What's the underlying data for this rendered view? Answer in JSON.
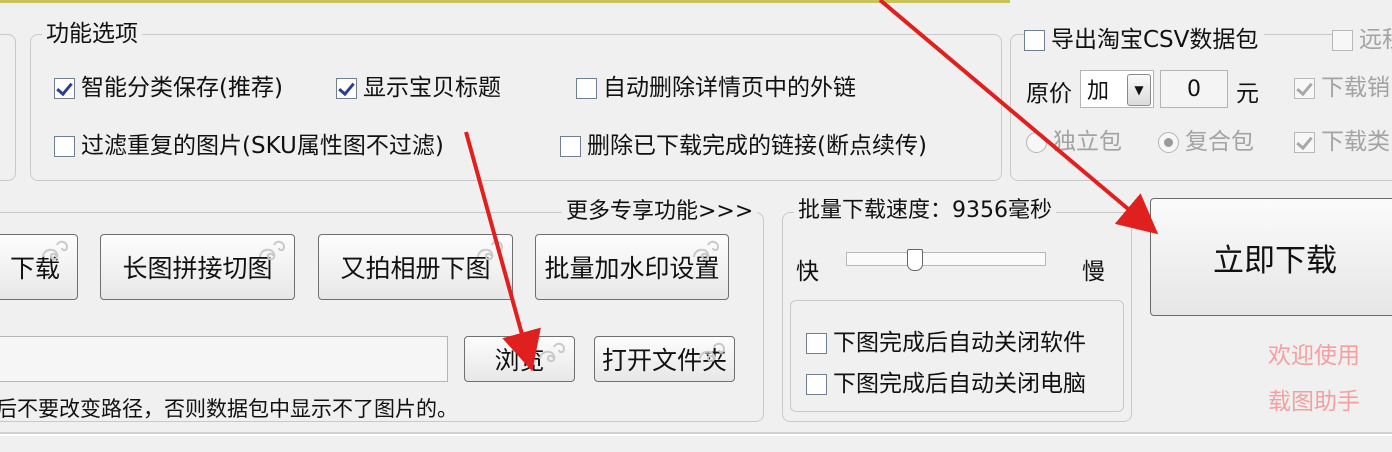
{
  "options": {
    "title": "功能选项",
    "smart_save": {
      "label": "智能分类保存(推荐)",
      "checked": true
    },
    "show_title": {
      "label": "显示宝贝标题",
      "checked": true
    },
    "auto_delete_links": {
      "label": "自动删除详情页中的外链",
      "checked": false
    },
    "filter_duplicates": {
      "label": "过滤重复的图片(SKU属性图不过滤)",
      "checked": false
    },
    "delete_completed": {
      "label": "删除已下载完成的链接(断点续传)",
      "checked": false
    }
  },
  "csv": {
    "export_label": "导出淘宝CSV数据包",
    "remote_label": "远程",
    "price_label": "原价",
    "price_op": "加",
    "price_value": "0",
    "unit": "元",
    "dl_sales_label": "下载销",
    "standalone_label": "独立包",
    "composite_label": "复合包",
    "dl_category_label": "下载类"
  },
  "tools": {
    "more_label": "更多专享功能>>>",
    "download_partial": "下载",
    "long_image": "长图拼接切图",
    "youpai": "又拍相册下图",
    "watermark": "批量加水印设置",
    "browse": "浏览",
    "open_folder": "打开文件夹",
    "path_hint": "后不要改变路径，否则数据包中显示不了图片的。",
    "path_value": ""
  },
  "speed": {
    "title": "批量下载速度：9356毫秒",
    "fast": "快",
    "slow": "慢",
    "slider_fraction": 0.32,
    "close_app": "下图完成后自动关闭软件",
    "shutdown": "下图完成后自动关闭电脑"
  },
  "download_now": "立即下载",
  "watermark_text": {
    "line1": "欢迎使用",
    "line2": "载图助手"
  },
  "colors": {
    "arrow": "#e0201e",
    "watermark": "#f2a0a0"
  }
}
